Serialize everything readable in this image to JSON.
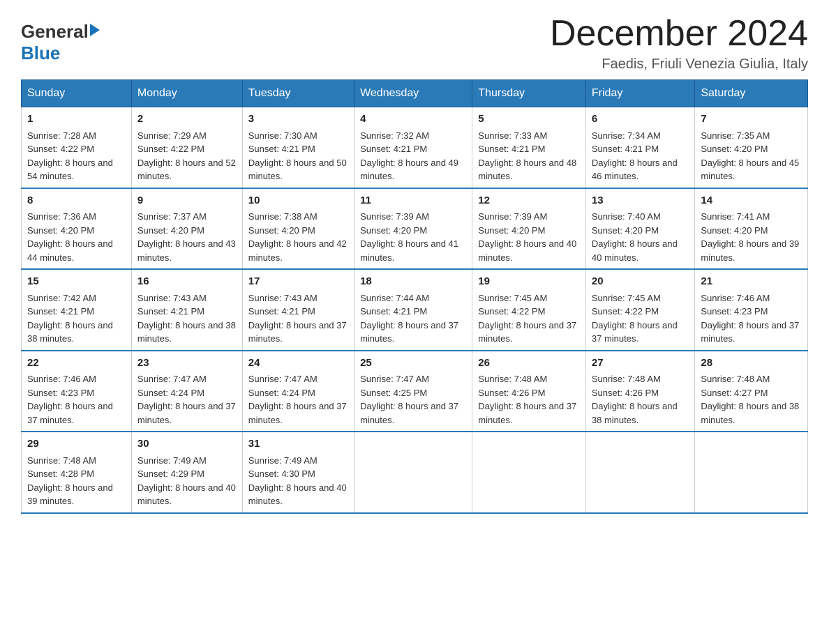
{
  "logo": {
    "general": "General",
    "blue": "Blue"
  },
  "title": "December 2024",
  "subtitle": "Faedis, Friuli Venezia Giulia, Italy",
  "days_of_week": [
    "Sunday",
    "Monday",
    "Tuesday",
    "Wednesday",
    "Thursday",
    "Friday",
    "Saturday"
  ],
  "weeks": [
    [
      {
        "day": "1",
        "sunrise": "7:28 AM",
        "sunset": "4:22 PM",
        "daylight": "8 hours and 54 minutes."
      },
      {
        "day": "2",
        "sunrise": "7:29 AM",
        "sunset": "4:22 PM",
        "daylight": "8 hours and 52 minutes."
      },
      {
        "day": "3",
        "sunrise": "7:30 AM",
        "sunset": "4:21 PM",
        "daylight": "8 hours and 50 minutes."
      },
      {
        "day": "4",
        "sunrise": "7:32 AM",
        "sunset": "4:21 PM",
        "daylight": "8 hours and 49 minutes."
      },
      {
        "day": "5",
        "sunrise": "7:33 AM",
        "sunset": "4:21 PM",
        "daylight": "8 hours and 48 minutes."
      },
      {
        "day": "6",
        "sunrise": "7:34 AM",
        "sunset": "4:21 PM",
        "daylight": "8 hours and 46 minutes."
      },
      {
        "day": "7",
        "sunrise": "7:35 AM",
        "sunset": "4:20 PM",
        "daylight": "8 hours and 45 minutes."
      }
    ],
    [
      {
        "day": "8",
        "sunrise": "7:36 AM",
        "sunset": "4:20 PM",
        "daylight": "8 hours and 44 minutes."
      },
      {
        "day": "9",
        "sunrise": "7:37 AM",
        "sunset": "4:20 PM",
        "daylight": "8 hours and 43 minutes."
      },
      {
        "day": "10",
        "sunrise": "7:38 AM",
        "sunset": "4:20 PM",
        "daylight": "8 hours and 42 minutes."
      },
      {
        "day": "11",
        "sunrise": "7:39 AM",
        "sunset": "4:20 PM",
        "daylight": "8 hours and 41 minutes."
      },
      {
        "day": "12",
        "sunrise": "7:39 AM",
        "sunset": "4:20 PM",
        "daylight": "8 hours and 40 minutes."
      },
      {
        "day": "13",
        "sunrise": "7:40 AM",
        "sunset": "4:20 PM",
        "daylight": "8 hours and 40 minutes."
      },
      {
        "day": "14",
        "sunrise": "7:41 AM",
        "sunset": "4:20 PM",
        "daylight": "8 hours and 39 minutes."
      }
    ],
    [
      {
        "day": "15",
        "sunrise": "7:42 AM",
        "sunset": "4:21 PM",
        "daylight": "8 hours and 38 minutes."
      },
      {
        "day": "16",
        "sunrise": "7:43 AM",
        "sunset": "4:21 PM",
        "daylight": "8 hours and 38 minutes."
      },
      {
        "day": "17",
        "sunrise": "7:43 AM",
        "sunset": "4:21 PM",
        "daylight": "8 hours and 37 minutes."
      },
      {
        "day": "18",
        "sunrise": "7:44 AM",
        "sunset": "4:21 PM",
        "daylight": "8 hours and 37 minutes."
      },
      {
        "day": "19",
        "sunrise": "7:45 AM",
        "sunset": "4:22 PM",
        "daylight": "8 hours and 37 minutes."
      },
      {
        "day": "20",
        "sunrise": "7:45 AM",
        "sunset": "4:22 PM",
        "daylight": "8 hours and 37 minutes."
      },
      {
        "day": "21",
        "sunrise": "7:46 AM",
        "sunset": "4:23 PM",
        "daylight": "8 hours and 37 minutes."
      }
    ],
    [
      {
        "day": "22",
        "sunrise": "7:46 AM",
        "sunset": "4:23 PM",
        "daylight": "8 hours and 37 minutes."
      },
      {
        "day": "23",
        "sunrise": "7:47 AM",
        "sunset": "4:24 PM",
        "daylight": "8 hours and 37 minutes."
      },
      {
        "day": "24",
        "sunrise": "7:47 AM",
        "sunset": "4:24 PM",
        "daylight": "8 hours and 37 minutes."
      },
      {
        "day": "25",
        "sunrise": "7:47 AM",
        "sunset": "4:25 PM",
        "daylight": "8 hours and 37 minutes."
      },
      {
        "day": "26",
        "sunrise": "7:48 AM",
        "sunset": "4:26 PM",
        "daylight": "8 hours and 37 minutes."
      },
      {
        "day": "27",
        "sunrise": "7:48 AM",
        "sunset": "4:26 PM",
        "daylight": "8 hours and 38 minutes."
      },
      {
        "day": "28",
        "sunrise": "7:48 AM",
        "sunset": "4:27 PM",
        "daylight": "8 hours and 38 minutes."
      }
    ],
    [
      {
        "day": "29",
        "sunrise": "7:48 AM",
        "sunset": "4:28 PM",
        "daylight": "8 hours and 39 minutes."
      },
      {
        "day": "30",
        "sunrise": "7:49 AM",
        "sunset": "4:29 PM",
        "daylight": "8 hours and 40 minutes."
      },
      {
        "day": "31",
        "sunrise": "7:49 AM",
        "sunset": "4:30 PM",
        "daylight": "8 hours and 40 minutes."
      },
      null,
      null,
      null,
      null
    ]
  ]
}
